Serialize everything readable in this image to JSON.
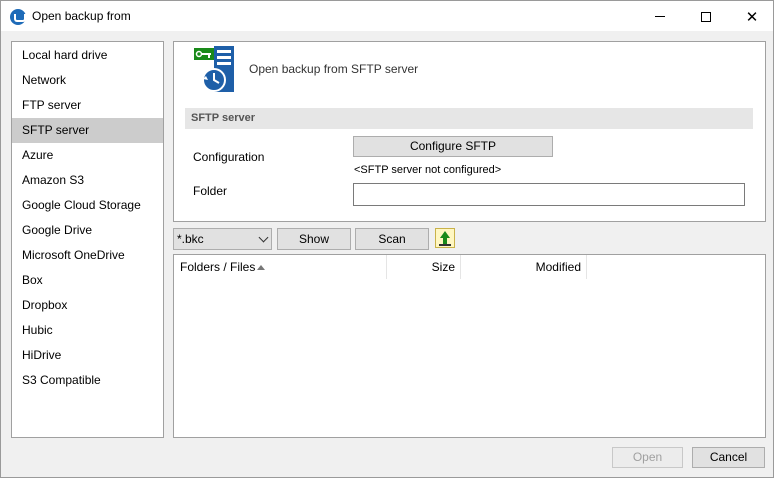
{
  "window": {
    "title": "Open backup from"
  },
  "sidebar": {
    "items": [
      {
        "label": "Local hard drive"
      },
      {
        "label": "Network"
      },
      {
        "label": "FTP server"
      },
      {
        "label": "SFTP server",
        "selected": true
      },
      {
        "label": "Azure"
      },
      {
        "label": "Amazon S3"
      },
      {
        "label": "Google Cloud Storage"
      },
      {
        "label": "Google Drive"
      },
      {
        "label": "Microsoft OneDrive"
      },
      {
        "label": "Box"
      },
      {
        "label": "Dropbox"
      },
      {
        "label": "Hubic"
      },
      {
        "label": "HiDrive"
      },
      {
        "label": "S3 Compatible"
      }
    ]
  },
  "panel": {
    "heading": "Open backup from SFTP server",
    "section_title": "SFTP server",
    "configuration_label": "Configuration",
    "configure_button": "Configure SFTP",
    "status_text": "<SFTP server not configured>",
    "folder_label": "Folder",
    "folder_value": ""
  },
  "toolbar": {
    "filter_value": "*.bkc",
    "show_label": "Show",
    "scan_label": "Scan"
  },
  "file_list": {
    "columns": [
      "Folders / Files",
      "Size",
      "Modified"
    ],
    "rows": []
  },
  "footer": {
    "open_label": "Open",
    "cancel_label": "Cancel"
  },
  "colors": {
    "selected_item": "#cccccc",
    "brand_blue": "#1e6bb8",
    "logo_green": "#1a8a1a"
  }
}
